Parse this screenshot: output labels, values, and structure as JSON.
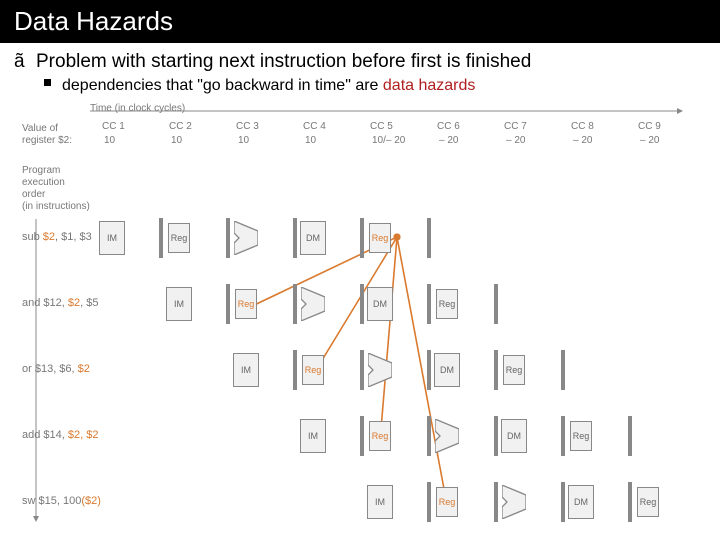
{
  "title": "Data Hazards",
  "bullet_symbol": "ã",
  "bullet_text": "Problem with starting next instruction before first is finished",
  "sub_text_pre": "dependencies that \"go backward in time\" are ",
  "sub_text_haz": "data hazards",
  "labels": {
    "time_hdr": "Time (in clock cycles)",
    "value_hdr_a": "Value of",
    "value_hdr_b": "register $2:",
    "prog_a": "Program",
    "prog_b": "execution",
    "prog_c": "order",
    "prog_d": "(in instructions)"
  },
  "cc": [
    "CC 1",
    "CC 2",
    "CC 3",
    "CC 4",
    "CC 5",
    "CC 6",
    "CC 7",
    "CC 8",
    "CC 9"
  ],
  "reg_vals": [
    "10",
    "10",
    "10",
    "10",
    "10/– 20",
    "– 20",
    "– 20",
    "– 20",
    "– 20"
  ],
  "instructions": [
    {
      "op": "sub",
      "text_a": "sub ",
      "r2": "$2",
      "text_b": ", $1, $3"
    },
    {
      "op": "and",
      "text_a": "and $12, ",
      "r2": "$2",
      "text_b": ", $5"
    },
    {
      "op": "or",
      "text_a": "or $13, $6, ",
      "r2": "$2",
      "text_b": ""
    },
    {
      "op": "add",
      "text_a": "add $14, ",
      "r2": "$2, $2",
      "text_b": ""
    },
    {
      "op": "sw",
      "text_a": "sw $15, 100",
      "r2": "($2)",
      "text_b": ""
    }
  ],
  "stage_labels": {
    "im": "IM",
    "reg": "Reg",
    "dm": "DM"
  },
  "chart_data": {
    "type": "table",
    "title": "Pipeline diagram – data hazard on register $2",
    "clock_cycles": [
      1,
      2,
      3,
      4,
      5,
      6,
      7,
      8,
      9
    ],
    "register_$2_value": [
      10,
      10,
      10,
      10,
      "10/-20",
      -20,
      -20,
      -20,
      -20
    ],
    "pipeline": [
      {
        "instruction": "sub $2, $1, $3",
        "dest": "$2",
        "stages": {
          "IF": 1,
          "ID": 2,
          "EX": 3,
          "MEM": 4,
          "WB": 5
        }
      },
      {
        "instruction": "and $12, $2, $5",
        "src": [
          "$2"
        ],
        "stages": {
          "IF": 2,
          "ID": 3,
          "EX": 4,
          "MEM": 5,
          "WB": 6
        }
      },
      {
        "instruction": "or $13, $6, $2",
        "src": [
          "$2"
        ],
        "stages": {
          "IF": 3,
          "ID": 4,
          "EX": 5,
          "MEM": 6,
          "WB": 7
        }
      },
      {
        "instruction": "add $14, $2, $2",
        "src": [
          "$2",
          "$2"
        ],
        "stages": {
          "IF": 4,
          "ID": 5,
          "EX": 6,
          "MEM": 7,
          "WB": 8
        }
      },
      {
        "instruction": "sw $15, 100($2)",
        "src": [
          "$2"
        ],
        "stages": {
          "IF": 5,
          "ID": 6,
          "EX": 7,
          "MEM": 8,
          "WB": 9
        }
      }
    ],
    "hazard_edges": [
      {
        "from": "sub WB (CC5)",
        "to": "and ID (CC3)",
        "backward": true
      },
      {
        "from": "sub WB (CC5)",
        "to": "or ID (CC4)",
        "backward": true
      },
      {
        "from": "sub WB (CC5)",
        "to": "add ID (CC5)",
        "backward": false
      },
      {
        "from": "sub WB (CC5)",
        "to": "sw ID (CC6)",
        "backward": false
      }
    ]
  }
}
